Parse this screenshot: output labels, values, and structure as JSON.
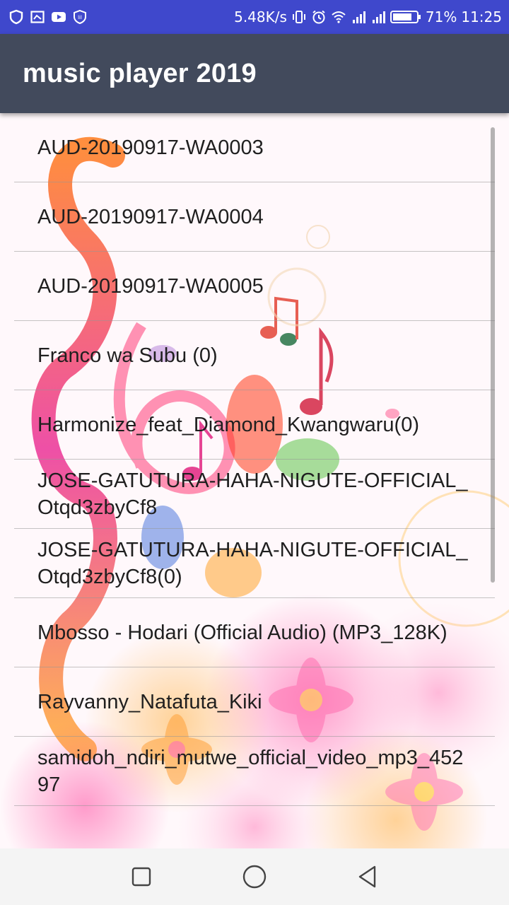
{
  "status_bar": {
    "net_speed": "5.48K/s",
    "battery": "71%",
    "time": "11:25",
    "left_icons": [
      "shield-icon",
      "screenshot-icon",
      "youtube-icon",
      "security-icon"
    ],
    "right_icons": [
      "vibrate-icon",
      "alarm-icon",
      "wifi-icon",
      "signal-icon",
      "signal-icon",
      "battery-icon"
    ]
  },
  "app_bar": {
    "title": "music player 2019"
  },
  "songs": [
    "AUD-20190917-WA0003",
    "AUD-20190917-WA0004",
    "AUD-20190917-WA0005",
    "Franco wa Subu (0)",
    "Harmonize_feat_Diamond_Kwangwaru(0)",
    "JOSE-GATUTURA-HAHA-NIGUTE-OFFICIAL_Otqd3zbyCf8",
    "JOSE-GATUTURA-HAHA-NIGUTE-OFFICIAL_Otqd3zbyCf8(0)",
    "Mbosso - Hodari (Official Audio) (MP3_128K)",
    "Rayvanny_Natafuta_Kiki",
    "samidoh_ndiri_mutwe_official_video_mp3_45297"
  ],
  "nav_bar": {
    "icons": [
      "recent-apps-icon",
      "home-icon",
      "back-icon"
    ]
  },
  "colors": {
    "status_bar": "#3f48cc",
    "app_bar": "#424a5c",
    "text": "#1f1f1f"
  }
}
